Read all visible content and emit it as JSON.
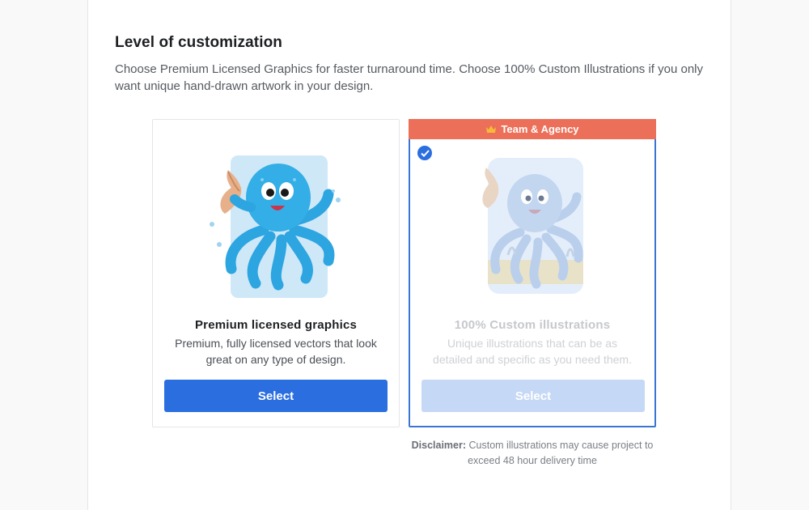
{
  "section": {
    "title": "Level of customization",
    "description": "Choose Premium Licensed Graphics for faster turnaround time. Choose 100% Custom Illustrations if you only want unique hand-drawn artwork in your design."
  },
  "options": [
    {
      "title": "Premium licensed graphics",
      "description": "Premium, fully licensed vectors that look great on any type of design.",
      "button_label": "Select",
      "illustration": "octopus-with-shell-icon"
    },
    {
      "ribbon_label": "Team & Agency",
      "ribbon_icon": "crown-icon",
      "selected": true,
      "title": "100% Custom illustrations",
      "description": "Unique illustrations that can be as detailed and specific as you need them.",
      "button_label": "Select",
      "illustration": "custom-octopus-icon"
    }
  ],
  "disclaimer": {
    "label": "Disclaimer:",
    "text": " Custom illustrations may cause project to exceed 48 hour delivery time"
  },
  "colors": {
    "primary": "#2a6ee0",
    "ribbon": "#ec6f59",
    "selected_border": "#3a75d6"
  }
}
